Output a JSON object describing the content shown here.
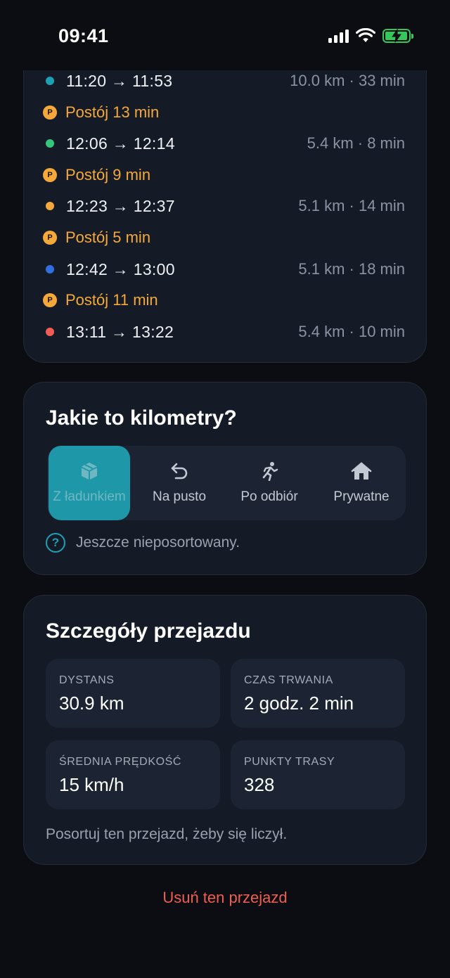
{
  "status_bar": {
    "time": "09:41"
  },
  "trips": [
    {
      "type": "trip",
      "time": "11:20 → 11:53",
      "meta": "10.0 km · 33 min",
      "color": "#1ea0b4"
    },
    {
      "type": "stop",
      "badge": "P",
      "text": "Postój 13 min",
      "color": "#f5a93a"
    },
    {
      "type": "trip",
      "time": "12:06 → 12:14",
      "meta": "5.4 km · 8 min",
      "color": "#34c77b"
    },
    {
      "type": "stop",
      "badge": "P",
      "text": "Postój 9 min",
      "color": "#f5a93a"
    },
    {
      "type": "trip",
      "time": "12:23 → 12:37",
      "meta": "5.1 km · 14 min",
      "color": "#f5a93a"
    },
    {
      "type": "stop",
      "badge": "P",
      "text": "Postój 5 min",
      "color": "#f5a93a"
    },
    {
      "type": "trip",
      "time": "12:42 → 13:00",
      "meta": "5.1 km · 18 min",
      "color": "#2f6fe0"
    },
    {
      "type": "stop",
      "badge": "P",
      "text": "Postój 11 min",
      "color": "#f5a93a"
    },
    {
      "type": "trip",
      "time": "13:11 → 13:22",
      "meta": "5.4 km · 10 min",
      "color": "#f25c54"
    }
  ],
  "km_type": {
    "title": "Jakie to kilometry?",
    "options": [
      {
        "label": "Z ładunkiem",
        "icon": "package-icon",
        "selected": true
      },
      {
        "label": "Na pusto",
        "icon": "return-arrow-icon",
        "selected": false
      },
      {
        "label": "Po odbiór",
        "icon": "running-person-icon",
        "selected": false
      },
      {
        "label": "Prywatne",
        "icon": "house-icon",
        "selected": false
      }
    ],
    "hint_icon": "?",
    "hint": "Jeszcze nieposortowany."
  },
  "details": {
    "title": "Szczegóły przejazdu",
    "stats": [
      {
        "label": "DYSTANS",
        "value": "30.9 km"
      },
      {
        "label": "CZAS TRWANIA",
        "value": "2 godz. 2 min"
      },
      {
        "label": "ŚREDNIA PRĘDKOŚĆ",
        "value": "15 km/h"
      },
      {
        "label": "PUNKTY TRASY",
        "value": "328"
      }
    ],
    "note": "Posortuj ten przejazd, żeby się liczył."
  },
  "delete_label": "Usuń ten przejazd",
  "colors": {
    "accent": "#1e98a8",
    "stop": "#f5a93a",
    "danger": "#ef5e4e"
  }
}
